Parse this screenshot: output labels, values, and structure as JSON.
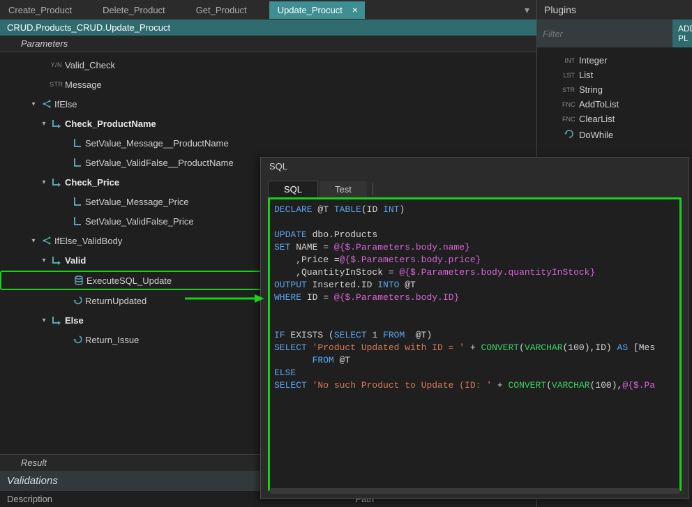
{
  "tabs": [
    {
      "label": "Create_Product",
      "active": false
    },
    {
      "label": "Delete_Product",
      "active": false
    },
    {
      "label": "Get_Product",
      "active": false
    },
    {
      "label": "Update_Procuct",
      "active": true
    }
  ],
  "breadcrumb": "CRUD.Products_CRUD.Update_Procuct",
  "sections": {
    "parameters": "Parameters",
    "result": "Result"
  },
  "tree": [
    {
      "indent": 55,
      "caret": "",
      "icon": "type",
      "type": "Y/N",
      "label": "Valid_Check",
      "bold": false
    },
    {
      "indent": 55,
      "caret": "",
      "icon": "type",
      "type": "STR",
      "label": "Message",
      "bold": false
    },
    {
      "indent": 40,
      "caret": "▾",
      "icon": "ifelse",
      "type": "",
      "label": "IfElse",
      "bold": false
    },
    {
      "indent": 55,
      "caret": "▾",
      "icon": "arrow-in",
      "type": "",
      "label": "Check_ProductName",
      "bold": true
    },
    {
      "indent": 84,
      "caret": "",
      "icon": "setval",
      "type": "",
      "label": "SetValue_Message__ProductName",
      "bold": false
    },
    {
      "indent": 84,
      "caret": "",
      "icon": "setval",
      "type": "",
      "label": "SetValue_ValidFalse__ProductName",
      "bold": false
    },
    {
      "indent": 55,
      "caret": "▾",
      "icon": "arrow-in",
      "type": "",
      "label": "Check_Price",
      "bold": true
    },
    {
      "indent": 84,
      "caret": "",
      "icon": "setval",
      "type": "",
      "label": "SetValue_Message_Price",
      "bold": false
    },
    {
      "indent": 84,
      "caret": "",
      "icon": "setval",
      "type": "",
      "label": "SetValue_ValidFalse_Price",
      "bold": false
    },
    {
      "indent": 40,
      "caret": "▾",
      "icon": "ifelse",
      "type": "",
      "label": "IfElse_ValidBody",
      "bold": false
    },
    {
      "indent": 55,
      "caret": "▾",
      "icon": "arrow-in",
      "type": "",
      "label": "Valid",
      "bold": true
    },
    {
      "indent": 84,
      "caret": "",
      "icon": "db",
      "type": "",
      "label": "ExecuteSQL_Update",
      "bold": false,
      "selected": true
    },
    {
      "indent": 84,
      "caret": "",
      "icon": "return",
      "type": "",
      "label": "ReturnUpdated",
      "bold": false
    },
    {
      "indent": 55,
      "caret": "▾",
      "icon": "arrow-in",
      "type": "",
      "label": "Else",
      "bold": true
    },
    {
      "indent": 84,
      "caret": "",
      "icon": "return",
      "type": "",
      "label": "Return_Issue",
      "bold": false
    }
  ],
  "validations": {
    "title": "Validations",
    "cols": [
      "Description",
      "Path"
    ]
  },
  "plugins": {
    "title": "Plugins",
    "filter_placeholder": "Filter",
    "add_btn": "ADD PL",
    "items": [
      {
        "tag": "INT",
        "name": "Integer"
      },
      {
        "tag": "LST",
        "name": "List"
      },
      {
        "tag": "STR",
        "name": "String"
      },
      {
        "tag": "FNC",
        "name": "AddToList"
      },
      {
        "tag": "FNC",
        "name": "ClearList"
      },
      {
        "tag": "ICO",
        "name": "DoWhile"
      }
    ]
  },
  "sql": {
    "title": "SQL",
    "tabs": [
      "SQL",
      "Test"
    ],
    "code": {
      "l1_a": "DECLARE",
      "l1_b": " @T ",
      "l1_c": "TABLE",
      "l1_d": "(ID ",
      "l1_e": "INT",
      "l1_f": ")",
      "l3_a": "UPDATE",
      "l3_b": " dbo.Products",
      "l4_a": "SET",
      "l4_b": " NAME = ",
      "l4_c": "@{$.Parameters.body.name}",
      "l5_a": "    ,Price =",
      "l5_b": "@{$.Parameters.body.price}",
      "l6_a": "    ,QuantityInStock = ",
      "l6_b": "@{$.Parameters.body.quantityInStock}",
      "l7_a": "OUTPUT",
      "l7_b": " Inserted.ID ",
      "l7_c": "INTO",
      "l7_d": " @T",
      "l8_a": "WHERE",
      "l8_b": " ID = ",
      "l8_c": "@{$.Parameters.body.ID}",
      "l11_a": "IF",
      "l11_b": " EXISTS (",
      "l11_c": "SELECT",
      "l11_d": " 1 ",
      "l11_e": "FROM",
      "l11_f": "  @T)",
      "l12_a": "SELECT",
      "l12_b": " 'Product Updated with ID = '",
      "l12_c": " + ",
      "l12_d": "CONVERT",
      "l12_e": "(",
      "l12_f": "VARCHAR",
      "l12_g": "(100),ID) ",
      "l12_h": "AS",
      "l12_i": " [Mes",
      "l13_a": "       FROM",
      "l13_b": " @T",
      "l14_a": "ELSE",
      "l15_a": "SELECT",
      "l15_b": " 'No such Product to Update (ID: '",
      "l15_c": " + ",
      "l15_d": "CONVERT",
      "l15_e": "(",
      "l15_f": "VARCHAR",
      "l15_g": "(100),",
      "l15_h": "@{$.Pa"
    }
  }
}
